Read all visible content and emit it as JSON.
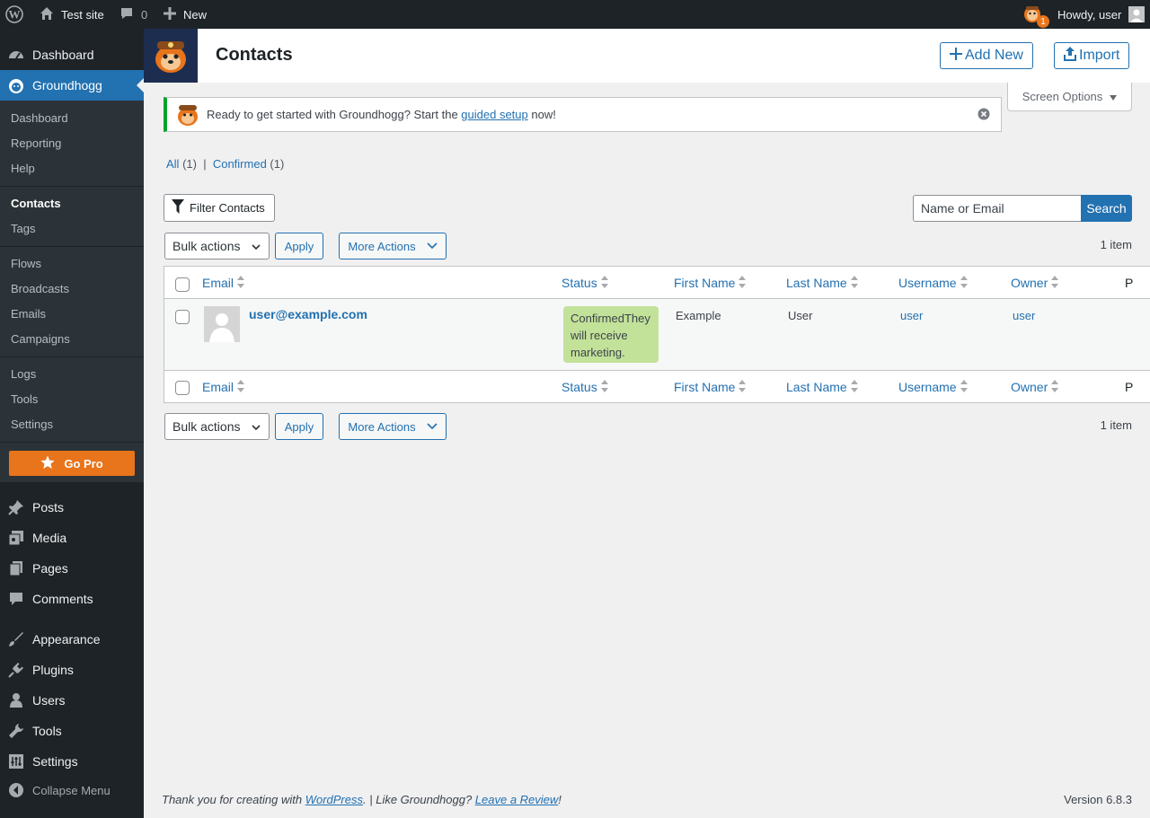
{
  "adminbar": {
    "site_name": "Test site",
    "comments_count": "0",
    "new_label": "New",
    "notification_count": "1",
    "howdy": "Howdy, user"
  },
  "sidebar": {
    "top": [
      {
        "label": "Dashboard",
        "icon": "dashboard-icon"
      },
      {
        "label": "Groundhogg",
        "icon": "groundhogg-icon"
      }
    ],
    "submenu": [
      "Dashboard",
      "Reporting",
      "Help",
      "Contacts",
      "Tags",
      "Flows",
      "Broadcasts",
      "Emails",
      "Campaigns",
      "Logs",
      "Tools",
      "Settings"
    ],
    "go_pro": "Go Pro",
    "bottom": [
      {
        "label": "Posts",
        "icon": "pin-icon"
      },
      {
        "label": "Media",
        "icon": "media-icon"
      },
      {
        "label": "Pages",
        "icon": "pages-icon"
      },
      {
        "label": "Comments",
        "icon": "comments-icon"
      },
      {
        "label": "Appearance",
        "icon": "brush-icon"
      },
      {
        "label": "Plugins",
        "icon": "plugin-icon"
      },
      {
        "label": "Users",
        "icon": "users-icon"
      },
      {
        "label": "Tools",
        "icon": "wrench-icon"
      },
      {
        "label": "Settings",
        "icon": "settings-icon"
      },
      {
        "label": "Collapse Menu",
        "icon": "collapse-icon"
      }
    ]
  },
  "header": {
    "title": "Contacts",
    "add_new": "Add New",
    "import": "Import"
  },
  "screen_options": "Screen Options",
  "notice": {
    "before": "Ready to get started with Groundhogg? Start the ",
    "link": "guided setup",
    "after": " now!"
  },
  "views": {
    "all_label": "All",
    "all_count": "(1)",
    "separator": "|",
    "confirmed_label": "Confirmed",
    "confirmed_count": "(1)"
  },
  "toolbar": {
    "filter_label": "Filter Contacts",
    "search_placeholder": "Name or Email",
    "search_button": "Search",
    "bulk_actions": "Bulk actions",
    "apply": "Apply",
    "more_actions": "More Actions",
    "items_count": "1 item"
  },
  "table": {
    "columns": [
      "Email",
      "Status",
      "First Name",
      "Last Name",
      "Username",
      "Owner",
      "P"
    ],
    "rows": [
      {
        "email": "user@example.com",
        "status": "ConfirmedThey will receive marketing.",
        "first_name": "Example",
        "last_name": "User",
        "username": "user",
        "owner": "user"
      }
    ]
  },
  "footer": {
    "thanks_before": "Thank you for creating with ",
    "wordpress": "WordPress",
    "thanks_middle": ". | Like Groundhogg? ",
    "review": "Leave a Review",
    "thanks_after": "!",
    "version": "Version 6.8.3"
  },
  "colors": {
    "admin_dark": "#1d2327",
    "accent": "#2271b1",
    "go_pro": "#e8741b",
    "status_confirmed": "#c2e29a",
    "notice_success": "#00a32a"
  }
}
